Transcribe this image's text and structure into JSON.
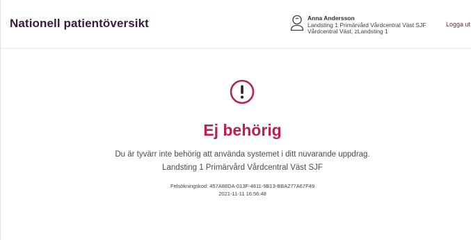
{
  "header": {
    "app_title": "Nationell patientöversikt",
    "user": {
      "name": "Anna Andersson",
      "role_line": "Landsting 1 Primärvård Vårdcentral Väst SJF",
      "unit_line": "Vårdcentral Väst, zLandsting 1"
    },
    "logout_label": "Logga ut"
  },
  "error": {
    "heading": "Ej behörig",
    "message_line1": "Du är tyvärr inte behörig att använda systemet i ditt nuvarande uppdrag.",
    "message_line2": "Landsting 1 Primärvård Vårdcentral Väst SJF",
    "debug_line": "Felsökningskod: 457A88DA-013F-4811-9B13-BBA277A67F49",
    "timestamp": "2021-11-11 16:56:48"
  },
  "colors": {
    "brand_dark": "#3b1a3c",
    "accent_red": "#b8224f",
    "link": "#7a1b4a"
  },
  "icons": {
    "user": "user-icon",
    "alert": "exclamation-circle-icon"
  }
}
